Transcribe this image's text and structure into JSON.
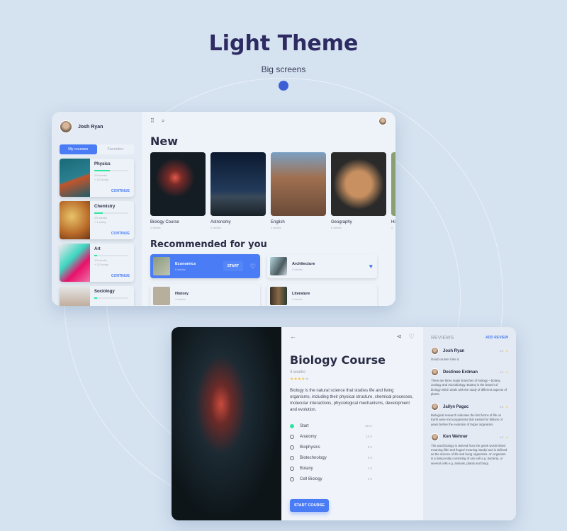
{
  "header": {
    "title": "Light Theme",
    "subtitle": "Big screens"
  },
  "sidebar": {
    "user": "Josh Ryan",
    "tabs": [
      "My courses",
      "Favorites"
    ],
    "courses": [
      {
        "name": "Physics",
        "progress": 0.45,
        "meta1": "2/4 weeks",
        "meta2": "+ 1/2 today",
        "action": "CONTINUE"
      },
      {
        "name": "Chemistry",
        "progress": 0.25,
        "meta1": "2/6 weeks",
        "meta2": "+ 1 today",
        "action": "CONTINUE"
      },
      {
        "name": "Art",
        "progress": 0.08,
        "meta1": "1/4 weeks",
        "meta2": "+ 1/2 today",
        "action": "CONTINUE"
      },
      {
        "name": "Sociology",
        "progress": 0.08
      }
    ]
  },
  "main": {
    "new_title": "New",
    "new": [
      {
        "name": "Biology Course",
        "weeks": "4 weeks"
      },
      {
        "name": "Astronomy",
        "weeks": "2 weeks"
      },
      {
        "name": "English",
        "weeks": "4 weeks"
      },
      {
        "name": "Geography",
        "weeks": "6 weeks"
      },
      {
        "name": "Hi",
        "weeks": "2"
      }
    ],
    "rec_title": "Recommended for you",
    "recommended": [
      {
        "name": "Economics",
        "weeks": "8 weeks",
        "action": "START"
      },
      {
        "name": "Architecture",
        "weeks": "2 weeks"
      },
      {
        "name": "History",
        "weeks": "4 weeks"
      },
      {
        "name": "Literature",
        "weeks": "2 weeks"
      }
    ]
  },
  "detail": {
    "title": "Biology Course",
    "weeks": "4 weeks",
    "rating": 4,
    "description": "Biology is the natural science that studies life and living organisms, including their physical structure, chemical processes, molecular interactions, physiological mechanisms, development and evolution.",
    "lessons": [
      {
        "name": "Start",
        "time": "15 m",
        "done": true
      },
      {
        "name": "Anatomy",
        "time": "10 h"
      },
      {
        "name": "Biophysics",
        "time": "8 h"
      },
      {
        "name": "Biotechnology",
        "time": "6 h"
      },
      {
        "name": "Botany",
        "time": "4 h"
      },
      {
        "name": "Cell Biology",
        "time": "3 h"
      }
    ],
    "start": "START COURSE"
  },
  "reviews": {
    "title": "REVIEWS",
    "add": "ADD REVIEW",
    "items": [
      {
        "name": "Josh Ryan",
        "score": "5.0",
        "text": "Good course! I like it."
      },
      {
        "name": "Destinee Erdman",
        "score": "4.5",
        "text": "There are three major branches of biology – botany, zoology and microbiology. Botany is the branch of biology which deals with the study of different aspects of plants."
      },
      {
        "name": "Jailyn Pagac",
        "score": "4.5",
        "text": "Biological research indicates the first forms of life on Earth were microorganisms that existed for billions of years before the evolution of larger organisms."
      },
      {
        "name": "Ken Wehner",
        "score": "4.5",
        "text": "The word biology is derived from the greek words /bios/ meaning /life/ and /logos/ meaning /study/ and is defined as the science of life and living organisms. An organism is a living entity consisting of one cell e.g. bacteria, or several cells e.g. animals, plants and fungi."
      }
    ]
  },
  "colors": {
    "accent": "#4a7cf5",
    "progress": "#2ee59d",
    "title": "#2e2b63",
    "star": "#f5c443"
  }
}
